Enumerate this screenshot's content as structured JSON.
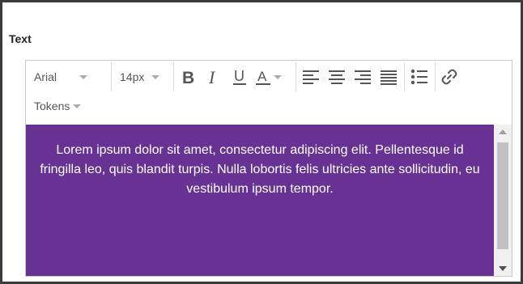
{
  "section": {
    "label": "Text"
  },
  "toolbar": {
    "font_family": "Arial",
    "font_size": "14px",
    "tokens_label": "Tokens"
  },
  "content": {
    "text": "Lorem ipsum dolor sit amet, consectetur adipiscing elit. Pellentesque id fringilla leo, quis blandit turpis. Nulla lobortis felis ultricies ante sollicitudin, eu vestibulum ipsum tempor."
  },
  "colors": {
    "content_background": "#673293",
    "content_text": "#ffffff",
    "icon": "#555555"
  },
  "icons": [
    "bold-icon",
    "italic-icon",
    "underline-icon",
    "text-color-icon",
    "align-left-icon",
    "align-center-icon",
    "align-right-icon",
    "align-justify-icon",
    "bullet-list-icon",
    "link-icon"
  ]
}
